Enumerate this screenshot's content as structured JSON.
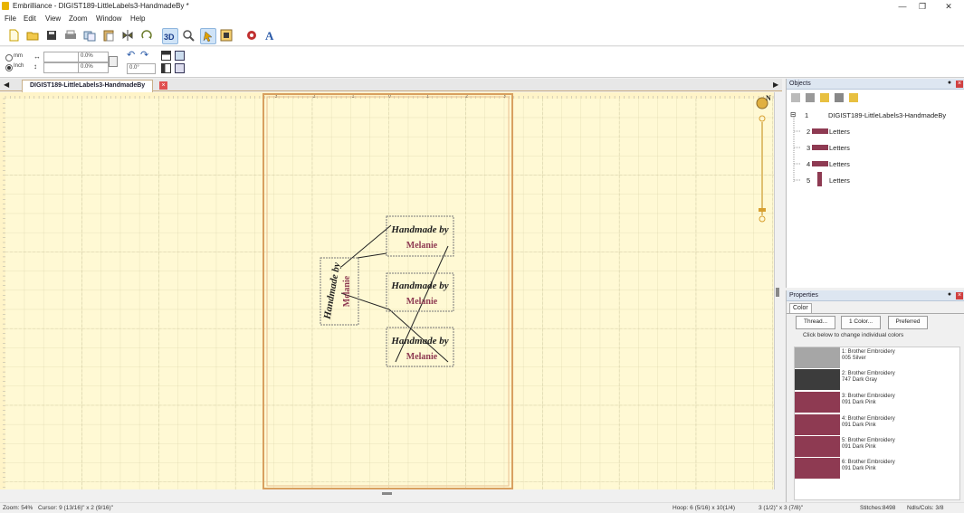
{
  "window": {
    "title": "Embrilliance - DIGIST189-LittleLabels3-HandmadeBy *",
    "controls": [
      "minimize",
      "maximize",
      "close"
    ]
  },
  "menu": [
    "File",
    "Edit",
    "View",
    "Zoom",
    "Window",
    "Help"
  ],
  "toolbar": {
    "buttons": [
      "new-icon",
      "open-icon",
      "save-icon",
      "print-icon",
      "copy-icon",
      "paste-icon",
      "mirror-icon",
      "rotate-icon",
      "3d-view-icon",
      "zoom-icon",
      "select-icon",
      "hoop-icon",
      "stitch-icon",
      "text-icon"
    ],
    "three_d_label": "3D",
    "text_label": "A"
  },
  "toolbar2": {
    "unit_mm": "mm",
    "unit_inch": "Inch",
    "selected_unit": "Inch",
    "width_pct": "0.0%",
    "height_pct": "0.0%",
    "angle": "0.0°"
  },
  "document_tab": {
    "label": "DIGIST189-LittleLabels3-HandmadeBy",
    "close": "×"
  },
  "canvas": {
    "background": "#fff9d4",
    "hoop_border": "#d8a060",
    "ruler_labels": [
      "-3",
      "-2",
      "-1",
      "0",
      "1",
      "2",
      "3"
    ],
    "compass_label": "N",
    "design_text_line1": "Handmade by",
    "design_text_line2": "Melanie"
  },
  "objects_panel": {
    "title": "Objects",
    "items": [
      {
        "index": "1",
        "label": "DIGIST189-LittleLabels3-HandmadeBy"
      },
      {
        "index": "2",
        "label": "Letters"
      },
      {
        "index": "3",
        "label": "Letters"
      },
      {
        "index": "4",
        "label": "Letters"
      },
      {
        "index": "5",
        "label": "Letters"
      }
    ]
  },
  "properties_panel": {
    "title": "Properties",
    "tab": "Color",
    "buttons": [
      "Thread...",
      "1 Color...",
      "Preferred"
    ],
    "hint": "Click below to change individual colors",
    "colors": [
      {
        "line1": "1: Brother Embroidery",
        "line2": "005 Silver",
        "hex": "#a6a6a6"
      },
      {
        "line1": "2: Brother Embroidery",
        "line2": "747 Dark Gray",
        "hex": "#3c3c3c"
      },
      {
        "line1": "3: Brother Embroidery",
        "line2": "091 Dark Pink",
        "hex": "#8e3a52"
      },
      {
        "line1": "4: Brother Embroidery",
        "line2": "091 Dark Pink",
        "hex": "#8e3a52"
      },
      {
        "line1": "5: Brother Embroidery",
        "line2": "091 Dark Pink",
        "hex": "#8e3a52"
      },
      {
        "line1": "6: Brother Embroidery",
        "line2": "091 Dark Pink",
        "hex": "#8e3a52"
      }
    ]
  },
  "status": {
    "zoom": "Zoom: 54%",
    "cursor": "Cursor: 9 (13/16)\" x 2 (9/16)\"",
    "hoop": "Hoop: 6 (5/16) x 10(1/4)",
    "size": "3 (1/2)\" x 3 (7/8)\"",
    "stitches": "Stitches:8498",
    "ndls": "Ndls/Cols: 3/8"
  }
}
